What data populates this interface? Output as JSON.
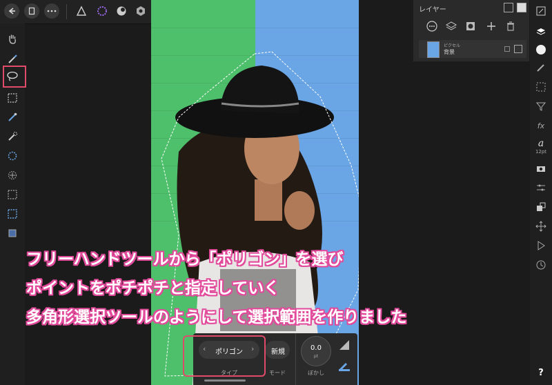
{
  "topbar": {
    "icons": [
      "back-icon",
      "document-icon",
      "more-icon",
      "designer-persona-icon",
      "liquify-persona-icon",
      "develop-persona-icon",
      "tone-mapping-persona-icon",
      "export-persona-icon",
      "pixel-persona-icon"
    ]
  },
  "layers_panel": {
    "title": "レイヤー",
    "layer": {
      "type": "ピクセル",
      "name": "背景"
    }
  },
  "studio_bar": {
    "font_size": "12pt",
    "help": "?"
  },
  "context_toolbar": {
    "type_value": "ポリゴン",
    "type_caption": "タイプ",
    "mode_value": "新規",
    "mode_caption": "モード",
    "feather_value": "0.0",
    "feather_unit": "pt",
    "feather_caption": "ぼかし"
  },
  "captions": {
    "line1": "フリーハンドツールから「ポリゴン」を選び",
    "line2": "ポイントをポチポチと指定していく",
    "line3": "多角形選択ツールのようにして選択範囲を作りました"
  },
  "colors": {
    "accent_pink": "#e24a9b",
    "highlight": "#e24a6a",
    "wall_green": "#4ec06c",
    "wall_blue": "#6aa6e6"
  }
}
